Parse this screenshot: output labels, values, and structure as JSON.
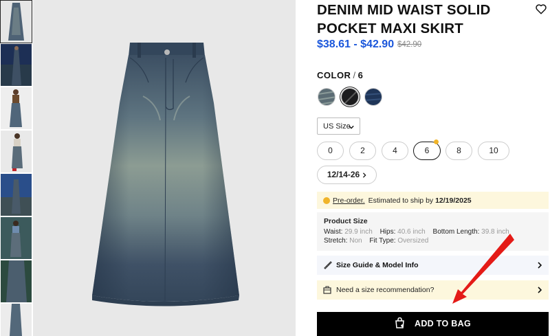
{
  "product": {
    "title": "DENIM MID WAIST SOLID POCKET MAXI SKIRT",
    "price_range": "$38.61 - $42.90",
    "original_price": "$42.90"
  },
  "color": {
    "label": "COLOR",
    "separator": "/",
    "selected": "6",
    "swatches": [
      "light-wash",
      "black",
      "dark-blue"
    ]
  },
  "size": {
    "system": "US Size",
    "options": [
      "0",
      "2",
      "4",
      "6",
      "8",
      "10"
    ],
    "selected": "6",
    "more_label": "12/14-26"
  },
  "preorder": {
    "link": "Pre-order.",
    "text": "Estimated to ship by",
    "date": "12/19/2025"
  },
  "product_size": {
    "heading": "Product Size",
    "waist_k": "Waist:",
    "waist_v": "29.9 inch",
    "hips_k": "Hips:",
    "hips_v": "40.6 inch",
    "bottom_k": "Bottom Length:",
    "bottom_v": "39.8 inch",
    "stretch_k": "Stretch:",
    "stretch_v": "Non",
    "fit_k": "Fit Type:",
    "fit_v": "Oversized"
  },
  "size_guide_label": "Size Guide & Model Info",
  "size_reco_label": "Need a size recommendation?",
  "add_to_bag_label": "ADD TO BAG",
  "icons": {
    "wishlist": "heart-icon",
    "dropdown": "chevron-down-icon",
    "next": "chevron-right-icon",
    "clock": "clock-icon",
    "ruler": "ruler-icon",
    "box": "box-icon",
    "bag": "shopping-bag-icon"
  },
  "colors": {
    "price": "#1a56db",
    "preorder_bg": "#fdf7dd",
    "button_bg": "#000000",
    "annotation_arrow": "#e41b17"
  }
}
